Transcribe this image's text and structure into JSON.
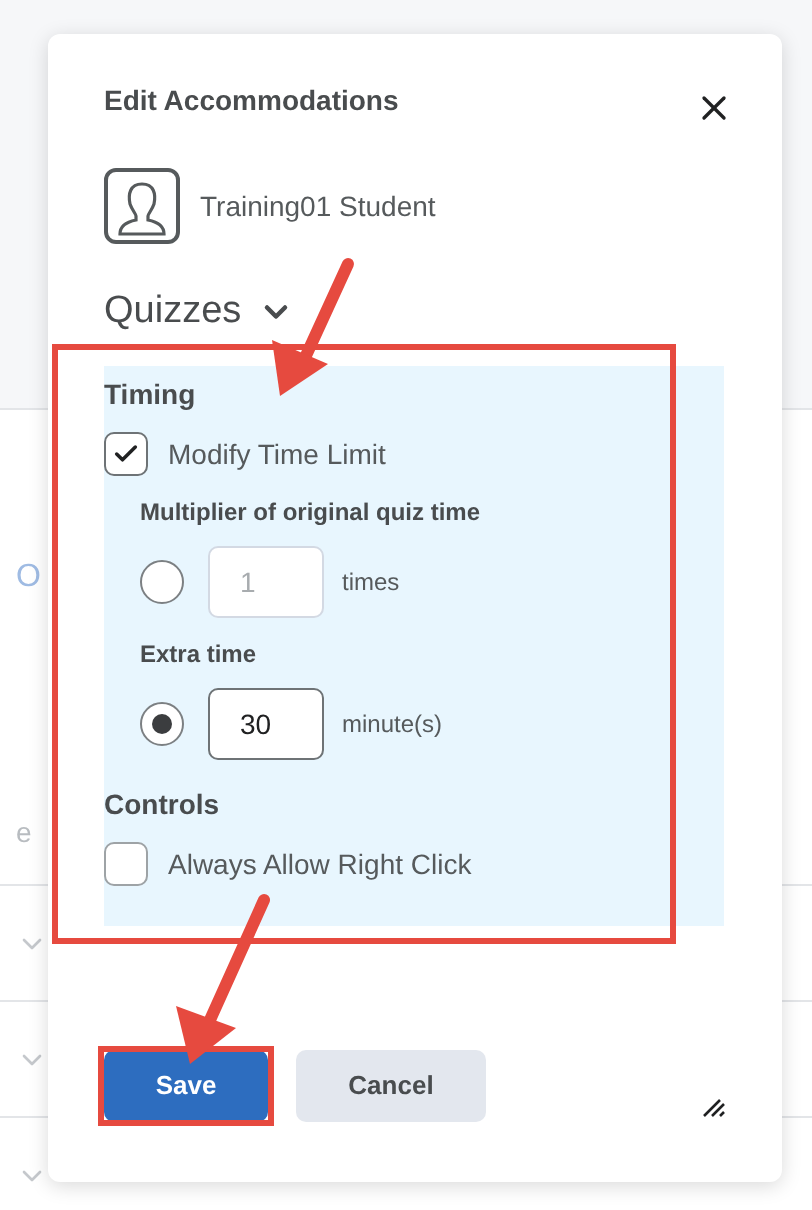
{
  "background": {
    "fragments": [
      "O",
      "e"
    ]
  },
  "dialog": {
    "title": "Edit Accommodations",
    "user": {
      "name": "Training01 Student"
    },
    "section": {
      "title": "Quizzes",
      "expanded": true
    },
    "timing": {
      "heading": "Timing",
      "modify": {
        "label": "Modify Time Limit",
        "checked": true
      },
      "options": [
        {
          "label": "Multiplier of original quiz time",
          "selected": false,
          "value": "1",
          "unit": "times",
          "disabled": true
        },
        {
          "label": "Extra time",
          "selected": true,
          "value": "30",
          "unit": "minute(s)",
          "disabled": false
        }
      ]
    },
    "controls": {
      "heading": "Controls",
      "options": [
        {
          "label": "Always Allow Right Click",
          "checked": false
        }
      ]
    },
    "buttons": [
      {
        "label": "Save",
        "kind": "primary"
      },
      {
        "label": "Cancel",
        "kind": "secondary"
      }
    ]
  }
}
